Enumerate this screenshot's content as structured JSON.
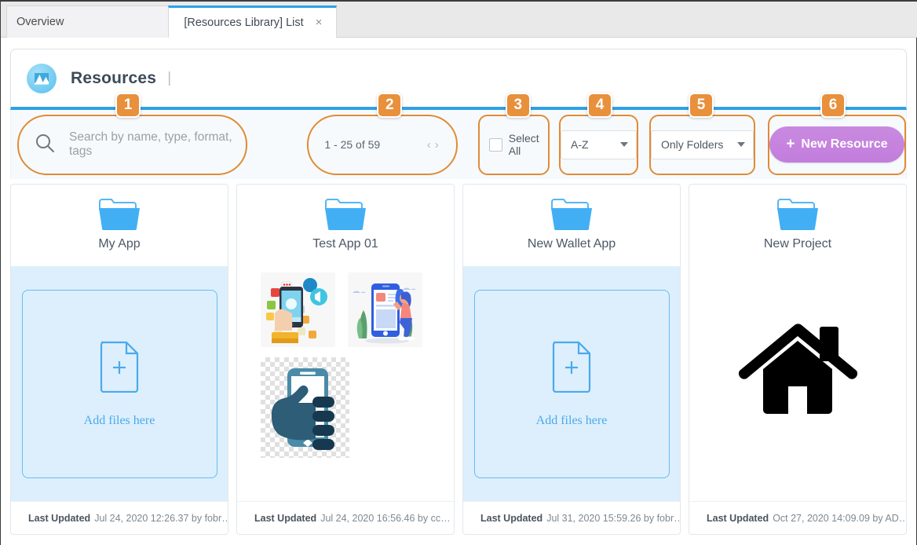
{
  "tabs": [
    {
      "label": "Overview",
      "active": false
    },
    {
      "label": "[Resources Library] List",
      "active": true,
      "close": "×"
    }
  ],
  "header": {
    "icon": "image-landscape-icon",
    "title": "Resources",
    "separator": "|"
  },
  "toolbar": {
    "search": {
      "badge": "1",
      "icon": "search-icon",
      "placeholder": "Search by name, type, format, tags",
      "value": ""
    },
    "pager": {
      "badge": "2",
      "range_text": "1 - 25 of 59",
      "prev": "‹",
      "next": "›"
    },
    "select_all": {
      "badge": "3",
      "label": "Select All",
      "checked": false
    },
    "sort": {
      "badge": "4",
      "value": "A-Z",
      "options": [
        "A-Z"
      ]
    },
    "filter": {
      "badge": "5",
      "value": "Only Folders",
      "options": [
        "Only Folders"
      ]
    },
    "new_resource": {
      "badge": "6",
      "plus": "+",
      "label": "New Resource"
    },
    "highlight_color": "#e08b37",
    "badge_color": "#e8903c",
    "accent_color": "#2fa1e5",
    "button_color": "#c27ddc"
  },
  "cards": [
    {
      "title": "My App",
      "icon": "folder-icon",
      "body": "dropzone",
      "dropzone_label": "Add files here",
      "footer_label": "Last Updated",
      "footer_value": "Jul 24, 2020 12:26.37 by fobr…"
    },
    {
      "title": "Test App 01",
      "icon": "folder-icon",
      "body": "thumbs",
      "thumbnails": [
        "hand-holding-phone-icons-illustration",
        "woman-with-phone-illustration",
        "hand-phone-glyph-transparent"
      ],
      "footer_label": "Last Updated",
      "footer_value": "Jul 24, 2020 16:56.46 by cc…"
    },
    {
      "title": "New Wallet App",
      "icon": "folder-icon",
      "body": "dropzone",
      "dropzone_label": "Add files here",
      "footer_label": "Last Updated",
      "footer_value": "Jul 31, 2020 15:59.26 by fobr…"
    },
    {
      "title": "New Project",
      "icon": "folder-icon",
      "body": "house",
      "image_name": "home-house-icon",
      "footer_label": "Last Updated",
      "footer_value": "Oct 27, 2020 14:09.09 by AD…"
    }
  ]
}
